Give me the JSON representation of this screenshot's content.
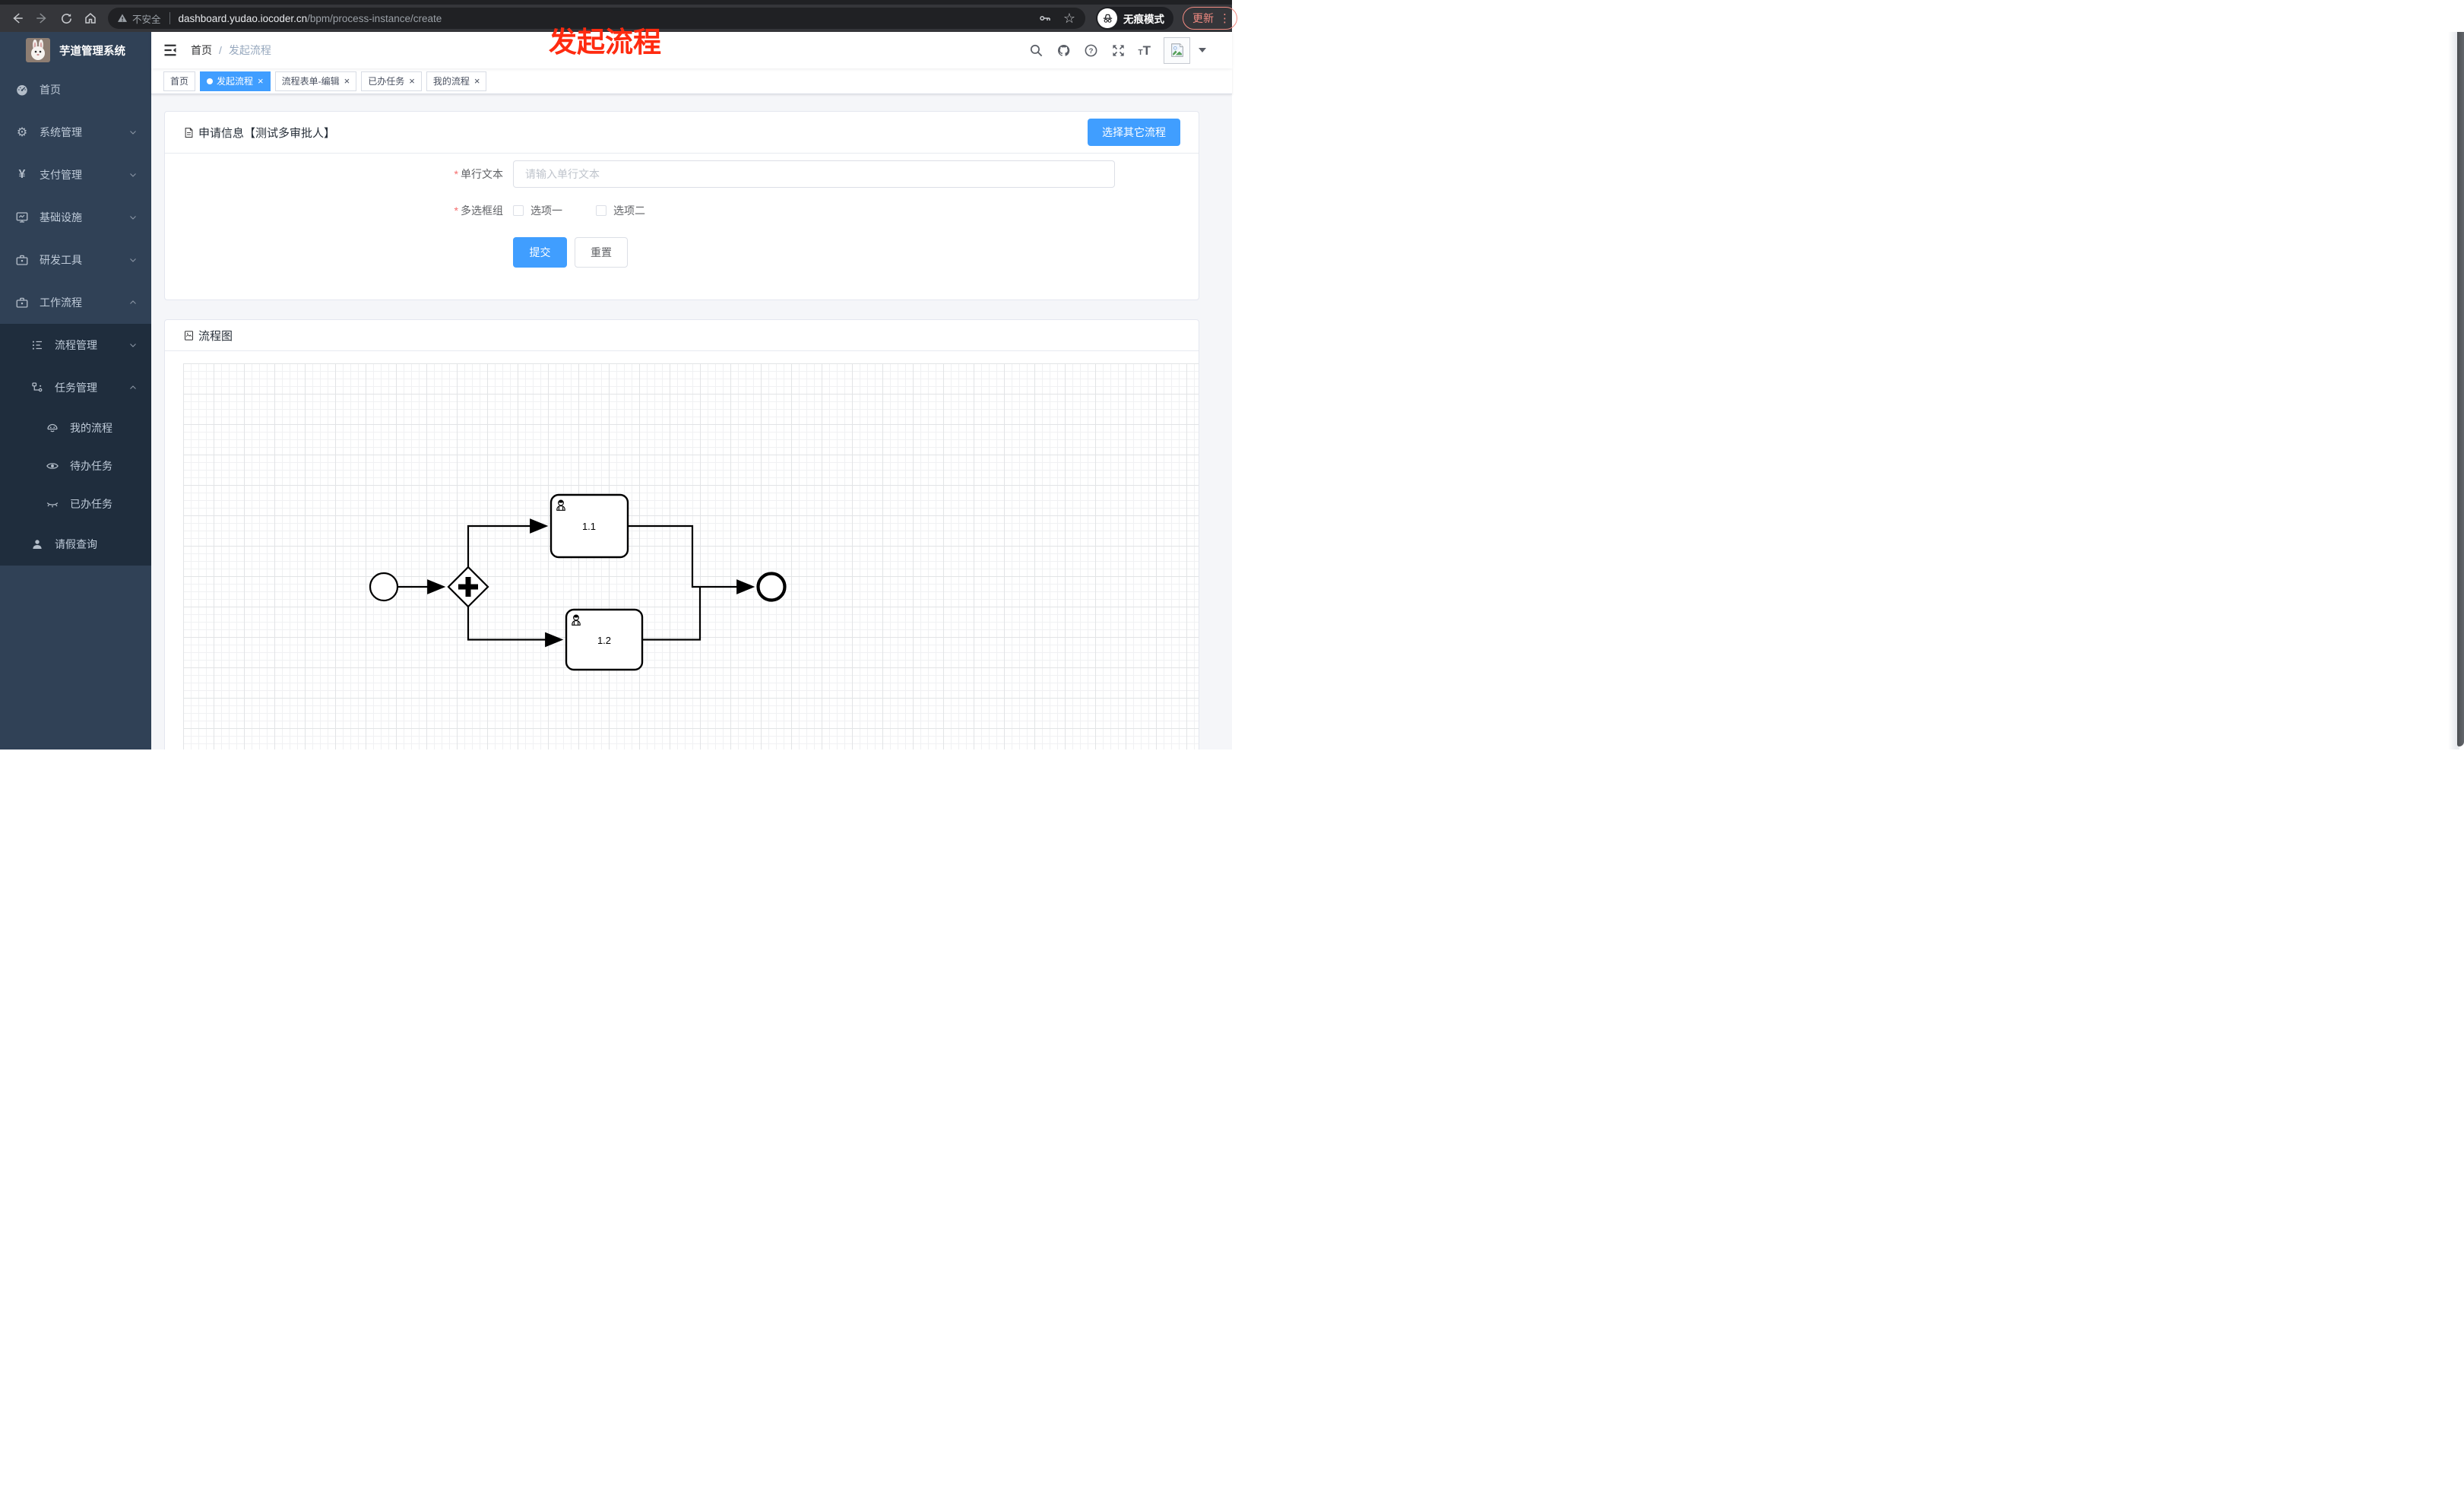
{
  "browser": {
    "security": "不安全",
    "url_domain": "dashboard.yudao.iocoder.cn",
    "url_path": "/bpm/process-instance/create",
    "incognito_label": "无痕模式",
    "update_label": "更新"
  },
  "annotation": {
    "text": "发起流程"
  },
  "icons": {
    "close": "×",
    "dots": "⋮",
    "star": "☆",
    "gear": "⚙",
    "yen": "¥",
    "question": "?",
    "t": "T"
  },
  "sidebar": {
    "title": "芋道管理系统",
    "items": [
      {
        "label": "首页"
      },
      {
        "label": "系统管理"
      },
      {
        "label": "支付管理"
      },
      {
        "label": "基础设施"
      },
      {
        "label": "研发工具"
      },
      {
        "label": "工作流程"
      },
      {
        "label": "流程管理"
      },
      {
        "label": "任务管理"
      },
      {
        "label": "我的流程"
      },
      {
        "label": "待办任务"
      },
      {
        "label": "已办任务"
      },
      {
        "label": "请假查询"
      }
    ]
  },
  "breadcrumb": {
    "home": "首页",
    "sep": "/",
    "current": "发起流程"
  },
  "tabs": [
    {
      "label": "首页"
    },
    {
      "label": "发起流程"
    },
    {
      "label": "流程表单-编辑"
    },
    {
      "label": "已办任务"
    },
    {
      "label": "我的流程"
    }
  ],
  "form_card": {
    "title": "申请信息【测试多审批人】",
    "required_mark": "*",
    "select_other_label": "选择其它流程",
    "text_field": {
      "label": "单行文本",
      "placeholder": "请输入单行文本"
    },
    "checkbox_field": {
      "label": "多选框组",
      "option1": "选项一",
      "option2": "选项二"
    },
    "submit_label": "提交",
    "reset_label": "重置"
  },
  "diagram_card": {
    "title": "流程图"
  },
  "diagram": {
    "task1": "1.1",
    "task2": "1.2"
  },
  "colors": {
    "primary": "#409eff",
    "annotation_red": "#ff2b10",
    "sidebar_bg": "#304156",
    "sidebar_submenu_bg": "#1f2d3d",
    "update_pill": "#f28b82"
  }
}
